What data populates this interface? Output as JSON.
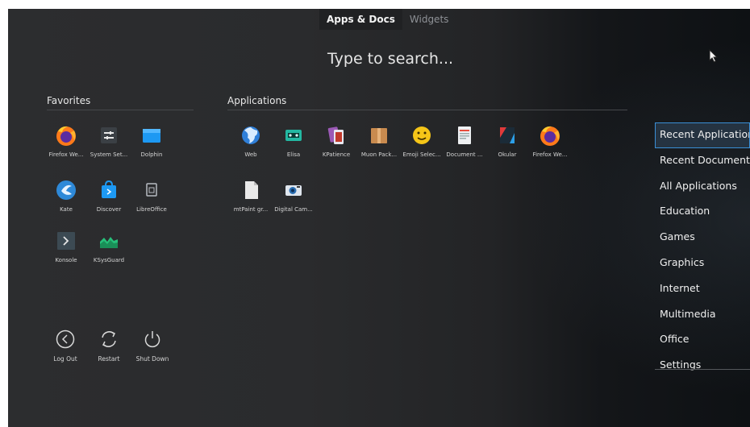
{
  "tabs": [
    {
      "label": "Apps & Docs",
      "active": true
    },
    {
      "label": "Widgets",
      "active": false
    }
  ],
  "search": {
    "placeholder": "Type to search..."
  },
  "favorites": {
    "title": "Favorites",
    "items": [
      {
        "label": "Firefox We...",
        "icon": "firefox-icon"
      },
      {
        "label": "System Set...",
        "icon": "system-settings-icon"
      },
      {
        "label": "Dolphin",
        "icon": "folder-icon"
      },
      {
        "label": "Kate",
        "icon": "kate-icon"
      },
      {
        "label": "Discover",
        "icon": "discover-bag-icon"
      },
      {
        "label": "LibreOffice",
        "icon": "libreoffice-icon"
      },
      {
        "label": "Konsole",
        "icon": "terminal-icon"
      },
      {
        "label": "KSysGuard",
        "icon": "system-monitor-icon"
      }
    ]
  },
  "applications": {
    "title": "Applications",
    "items": [
      {
        "label": "Web",
        "icon": "globe-icon"
      },
      {
        "label": "Elisa",
        "icon": "music-player-icon"
      },
      {
        "label": "KPatience",
        "icon": "cards-icon"
      },
      {
        "label": "Muon Pack...",
        "icon": "package-icon"
      },
      {
        "label": "Emoji Selec...",
        "icon": "emoji-icon"
      },
      {
        "label": "Document ...",
        "icon": "document-viewer-icon"
      },
      {
        "label": "Okular",
        "icon": "okular-icon"
      },
      {
        "label": "Firefox We...",
        "icon": "firefox-icon"
      },
      {
        "label": "mtPaint gr...",
        "icon": "paint-document-icon"
      },
      {
        "label": "Digital Cam...",
        "icon": "camera-icon"
      }
    ]
  },
  "power": [
    {
      "label": "Log Out",
      "icon": "logout-icon"
    },
    {
      "label": "Restart",
      "icon": "restart-icon"
    },
    {
      "label": "Shut Down",
      "icon": "power-icon"
    }
  ],
  "categories": [
    {
      "label": "Recent Applications",
      "active": true
    },
    {
      "label": "Recent Documents",
      "active": false
    },
    {
      "label": "All Applications",
      "active": false
    },
    {
      "label": "Education",
      "active": false
    },
    {
      "label": "Games",
      "active": false
    },
    {
      "label": "Graphics",
      "active": false
    },
    {
      "label": "Internet",
      "active": false
    },
    {
      "label": "Multimedia",
      "active": false
    },
    {
      "label": "Office",
      "active": false
    },
    {
      "label": "Settings",
      "active": false
    }
  ],
  "colors": {
    "accent": "#3a8fd6",
    "orange": "#e08a2c"
  }
}
